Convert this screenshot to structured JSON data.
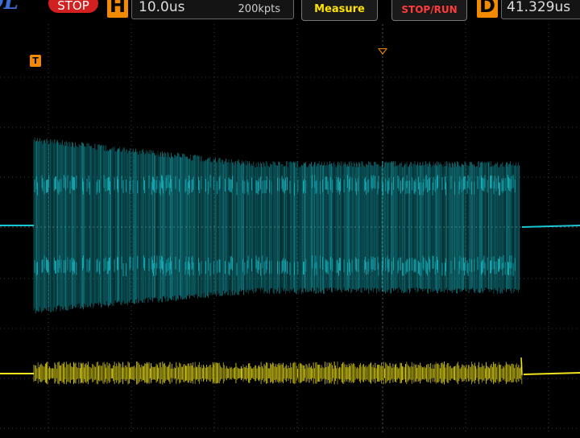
{
  "header": {
    "brand": "OL",
    "run_state": "STOP",
    "horizontal": {
      "key": "H",
      "timebase": "10.0us",
      "memory_depth": "200kpts"
    },
    "measure_label": "Measure",
    "stop_run_label": "STOP/RUN",
    "delay": {
      "key": "D",
      "value": "41.329us"
    }
  },
  "scope": {
    "trigger_marker": "T",
    "channels": [
      {
        "name": "ch1-cyan",
        "color": "#19c6d3"
      },
      {
        "name": "ch2-yellow",
        "color": "#f2e41c"
      }
    ],
    "grid_color": "#3a3a3a"
  }
}
